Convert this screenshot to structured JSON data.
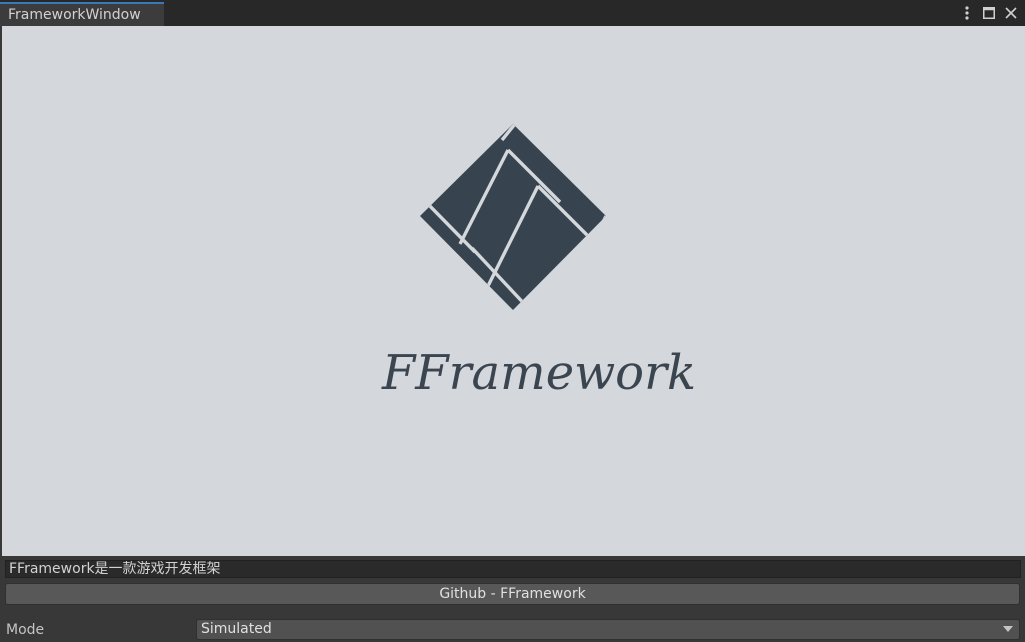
{
  "window": {
    "tab_title": "FrameworkWindow",
    "menu_icon": "kebab-menu-icon",
    "maximize_icon": "maximize-icon",
    "close_icon": "close-icon"
  },
  "banner": {
    "logo_icon": "framework-diamond-logo",
    "logo_text": "FFramework",
    "background_color": "#d4d7dc",
    "logo_color": "#3a4550"
  },
  "description": {
    "value": "FFramework是一款游戏开发框架"
  },
  "github_button": {
    "label": "Github - FFramework"
  },
  "mode": {
    "label": "Mode",
    "selected": "Simulated"
  },
  "colors": {
    "tab_accent": "#3a79bb",
    "panel_bg": "#383838"
  }
}
